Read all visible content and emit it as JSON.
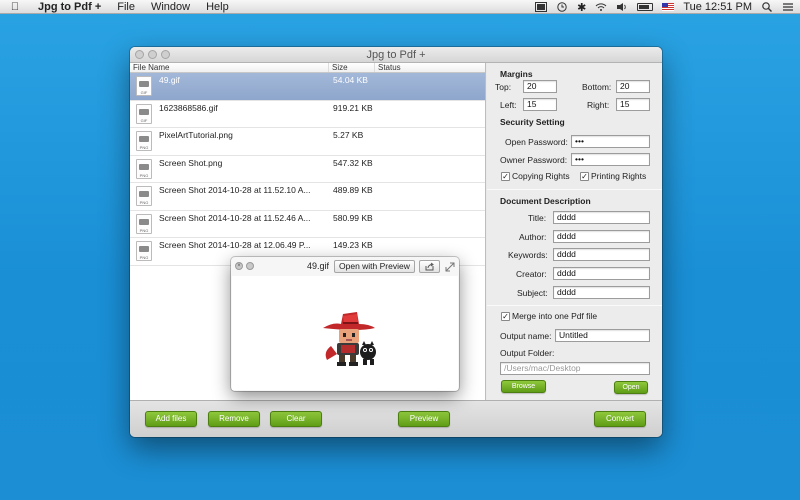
{
  "menubar": {
    "app_name": "Jpg to Pdf +",
    "menus": [
      "File",
      "Window",
      "Help"
    ],
    "clock": "Tue 12:51 PM"
  },
  "window": {
    "title": "Jpg to Pdf +"
  },
  "file_list": {
    "columns": [
      "File Name",
      "Size",
      "Status"
    ],
    "rows": [
      {
        "name": "49.gif",
        "size": "54.04 KB",
        "type": "GIF",
        "selected": true
      },
      {
        "name": "1623868586.gif",
        "size": "919.21 KB",
        "type": "GIF",
        "selected": false
      },
      {
        "name": "PixelArtTutorial.png",
        "size": "5.27 KB",
        "type": "PNG",
        "selected": false
      },
      {
        "name": "Screen Shot.png",
        "size": "547.32 KB",
        "type": "PNG",
        "selected": false
      },
      {
        "name": "Screen Shot 2014-10-28 at 11.52.10 A...",
        "size": "489.89 KB",
        "type": "PNG",
        "selected": false
      },
      {
        "name": "Screen Shot 2014-10-28 at 11.52.46 A...",
        "size": "580.99 KB",
        "type": "PNG",
        "selected": false
      },
      {
        "name": "Screen Shot 2014-10-28 at 12.06.49 P...",
        "size": "149.23 KB",
        "type": "PNG",
        "selected": false
      }
    ]
  },
  "margins": {
    "title": "Margins",
    "top_label": "Top:",
    "top_value": "20",
    "bottom_label": "Bottom:",
    "bottom_value": "20",
    "left_label": "Left:",
    "left_value": "15",
    "right_label": "Right:",
    "right_value": "15"
  },
  "security": {
    "title": "Security Setting",
    "open_password_label": "Open Password:",
    "open_password_value": "•••",
    "owner_password_label": "Owner Password:",
    "owner_password_value": "•••",
    "copying_rights_label": "Copying Rights",
    "copying_rights_checked": true,
    "printing_rights_label": "Printing Rights",
    "printing_rights_checked": true
  },
  "document": {
    "title": "Document Description",
    "title_label": "Title:",
    "title_value": "dddd",
    "author_label": "Author:",
    "author_value": "dddd",
    "keywords_label": "Keywords:",
    "keywords_value": "dddd",
    "creator_label": "Creator:",
    "creator_value": "dddd",
    "subject_label": "Subject:",
    "subject_value": "dddd"
  },
  "output": {
    "merge_label": "Merge into one Pdf file",
    "merge_checked": true,
    "name_label": "Output name:",
    "name_value": "Untitled",
    "folder_label": "Output Folder:",
    "folder_placeholder": "/Users/mac/Desktop",
    "browse_label": "Browse",
    "open_label": "Open"
  },
  "toolbar": {
    "add_files": "Add files",
    "remove": "Remove",
    "clear": "Clear",
    "preview": "Preview",
    "convert": "Convert"
  },
  "quicklook": {
    "file_name": "49.gif",
    "open_with": "Open with Preview"
  },
  "colors": {
    "desktop": "#1a8fd6",
    "selection": "#98aed3",
    "button_green": "#6aa81f"
  }
}
